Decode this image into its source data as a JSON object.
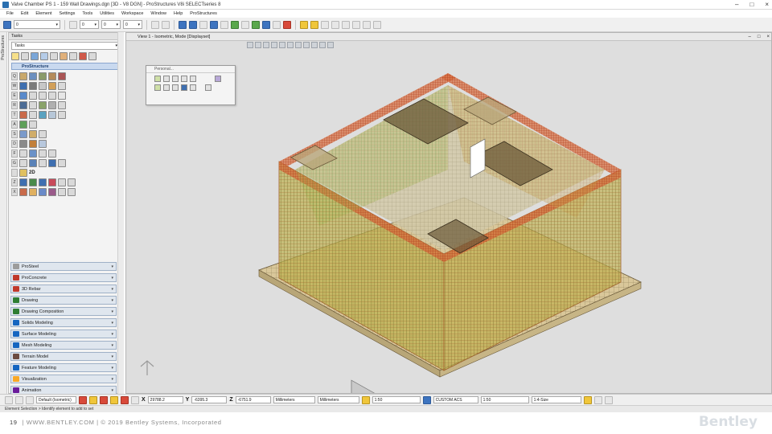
{
  "window": {
    "title": "Valve Chamber PS 1 - 159 Wall Drawings.dgn [3D - V8 DGN] - ProStructures V8i SELECTseries 8",
    "controls": [
      "–",
      "□",
      "×"
    ]
  },
  "menu": [
    "File",
    "Edit",
    "Element",
    "Settings",
    "Tools",
    "Utilities",
    "Workspace",
    "Window",
    "Help",
    "ProStructures"
  ],
  "toolbar": {
    "level_select": "0",
    "color_select": "0",
    "weight_select": "0",
    "style_select": "0"
  },
  "side_tab": {
    "label": "ProStructures"
  },
  "tasks": {
    "header": "Tasks",
    "select_value": "Tasks",
    "section_label": "ProStructure",
    "row_keys": [
      "Q",
      "W",
      "E",
      "R",
      "T",
      "A",
      "S",
      "D",
      "F",
      "G",
      "Z",
      "X"
    ],
    "label_2d": "2D",
    "items": [
      {
        "label": "ProSteel",
        "color": "#9c9c9c"
      },
      {
        "label": "ProConcrete",
        "color": "#c0392b"
      },
      {
        "label": "3D Rebar",
        "color": "#c0392b"
      },
      {
        "label": "Drawing",
        "color": "#2e7d32"
      },
      {
        "label": "Drawing Composition",
        "color": "#2e7d32"
      },
      {
        "label": "Solids Modeling",
        "color": "#1565c0"
      },
      {
        "label": "Surface Modeling",
        "color": "#1565c0"
      },
      {
        "label": "Mesh Modeling",
        "color": "#1565c0"
      },
      {
        "label": "Terrain Model",
        "color": "#6d4c41"
      },
      {
        "label": "Feature Modeling",
        "color": "#1565c0"
      },
      {
        "label": "Visualization",
        "color": "#f9a825"
      },
      {
        "label": "Animation",
        "color": "#6a1b9a"
      }
    ]
  },
  "view": {
    "title": "View 1 - Isometric, Mode [Displayset]",
    "floating_toolbar_title": "Personal..."
  },
  "status": {
    "view_select": "Default (Isometric)",
    "x_label": "X",
    "x_value": "29788.2",
    "y_label": "Y",
    "y_value": "-6395.3",
    "z_label": "Z",
    "z_value": "-6751.9",
    "unit1": "Millimeters",
    "unit2": "Millimeters",
    "scale1": "1:50",
    "acs": "CUSTOM ACS",
    "scale2": "1:50",
    "size": "1:4-Size",
    "prompt": "Element Selection > Identify element to add to set"
  },
  "footer": {
    "page": "19",
    "text": "| WWW.BENTLEY.COM | © 2019 Bentley Systems, Incorporated",
    "brand": "Bentley"
  },
  "colors": {
    "rebar_red": "#c84a2c",
    "rebar_green": "#4e8a2e",
    "concrete_tan": "#d9c79a",
    "slab_dark": "#6b5a3a"
  }
}
